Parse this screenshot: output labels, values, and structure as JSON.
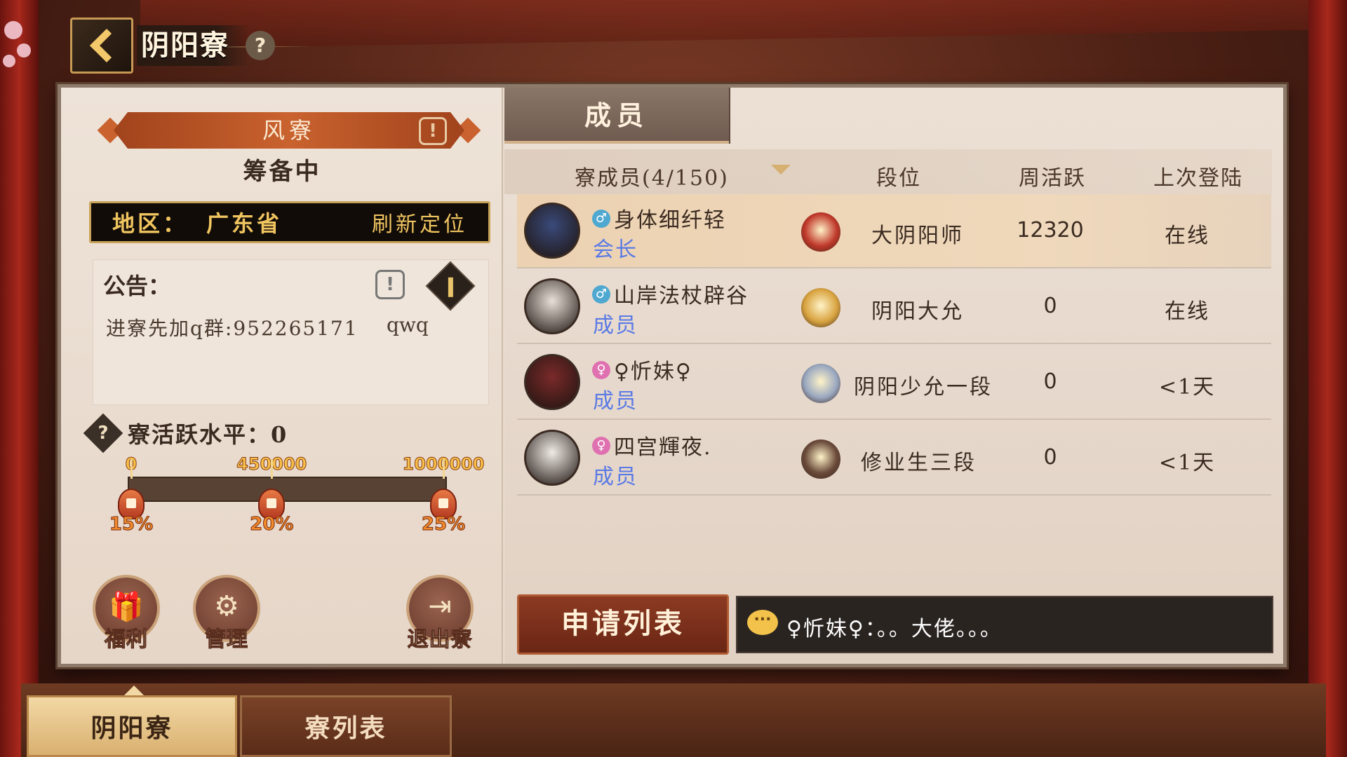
{
  "header": {
    "title": "阴阳寮",
    "back_icon": "back-arrow-icon",
    "help_icon": "question-icon"
  },
  "guild": {
    "name": "风寮",
    "status": "筹备中",
    "region_label": "地区：",
    "region_value": "广东省",
    "refresh_label": "刷新定位"
  },
  "notice": {
    "title": "公告：",
    "text": "进寮先加q群:952265171",
    "tail": "qwq"
  },
  "activity": {
    "title": "寮活跃水平：0",
    "value": 0,
    "max": 1000000,
    "milestones": [
      {
        "value": 0,
        "label": "0",
        "bonus": "15%"
      },
      {
        "value": 450000,
        "label": "450000",
        "bonus": "20%"
      },
      {
        "value": 1000000,
        "label": "1000000",
        "bonus": "25%"
      }
    ]
  },
  "actions": {
    "welfare": "福利",
    "manage": "管理",
    "leave": "退出寮"
  },
  "members_tab": "成员",
  "columns": {
    "members": "寮成员(4/150)",
    "rank": "段位",
    "weekly_activity": "周活跃",
    "last_login": "上次登陆"
  },
  "members": [
    {
      "name": "身体细纤轻",
      "role": "会长",
      "gender": "male",
      "rank": "大阴阳师",
      "activity": "12320",
      "last_login": "在线",
      "selected": true,
      "avatar_color": "#3a4a7a",
      "rank_color": "#c0392b"
    },
    {
      "name": "山岸法杖辟谷",
      "role": "成员",
      "gender": "male",
      "rank": "阴阳大允",
      "activity": "0",
      "last_login": "在线",
      "selected": false,
      "avatar_color": "#e8e0d8",
      "rank_color": "#d9a441"
    },
    {
      "name": "♀忻妹♀",
      "role": "成员",
      "gender": "female",
      "rank": "阴阳少允一段",
      "activity": "0",
      "last_login": "<1天",
      "selected": false,
      "avatar_color": "#7a2a2a",
      "rank_color": "#9aa8c0"
    },
    {
      "name": "四宫輝夜.",
      "role": "成员",
      "gender": "female",
      "rank": "修业生三段",
      "activity": "0",
      "last_login": "<1天",
      "selected": false,
      "avatar_color": "#f0ebe6",
      "rank_color": "#6a4a3a"
    }
  ],
  "apply_button": "申请列表",
  "chat": {
    "icon": "chat-bubble-icon",
    "text": "♀忻妹♀：。。大佬。。。"
  },
  "bottom_tabs": {
    "active": "阴阳寮",
    "inactive": "寮列表"
  }
}
